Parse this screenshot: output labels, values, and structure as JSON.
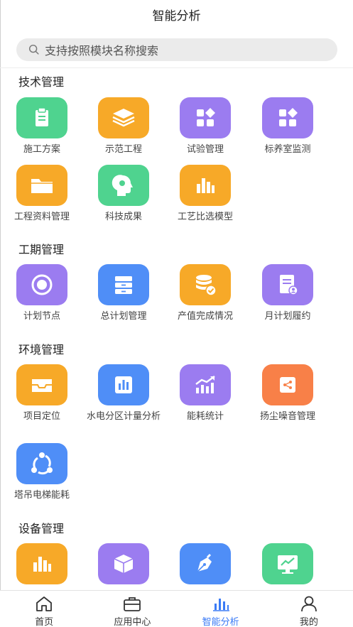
{
  "header": {
    "title": "智能分析"
  },
  "search": {
    "placeholder": "支持按照模块名称搜索"
  },
  "sections": [
    {
      "title": "技术管理",
      "items": [
        {
          "label": "施工方案",
          "icon": "clipboard-icon",
          "color": "#4fd38f"
        },
        {
          "label": "示范工程",
          "icon": "layers-icon",
          "color": "#f7a928"
        },
        {
          "label": "试验管理",
          "icon": "apps-grid-icon",
          "color": "#9b7cf0"
        },
        {
          "label": "标养室监测",
          "icon": "apps-grid-icon",
          "color": "#9b7cf0"
        },
        {
          "label": "工程资料管理",
          "icon": "folder-icon",
          "color": "#f7a928"
        },
        {
          "label": "科技成果",
          "icon": "head-brain-icon",
          "color": "#4fd38f"
        },
        {
          "label": "工艺比选模型",
          "icon": "bar-chart-icon",
          "color": "#f7a928"
        }
      ]
    },
    {
      "title": "工期管理",
      "items": [
        {
          "label": "计划节点",
          "icon": "circle-node-icon",
          "color": "#9b7cf0"
        },
        {
          "label": "总计划管理",
          "icon": "cabinet-icon",
          "color": "#4f8ef7"
        },
        {
          "label": "产值完成情况",
          "icon": "database-check-icon",
          "color": "#f7a928"
        },
        {
          "label": "月计划履约",
          "icon": "document-user-icon",
          "color": "#9b7cf0"
        }
      ]
    },
    {
      "title": "环境管理",
      "items": [
        {
          "label": "项目定位",
          "icon": "inbox-tray-icon",
          "color": "#f7a928"
        },
        {
          "label": "水电分区计量分析",
          "icon": "bar-chart-icon",
          "color": "#4f8ef7"
        },
        {
          "label": "能耗统计",
          "icon": "trend-chart-icon",
          "color": "#9b7cf0"
        },
        {
          "label": "扬尘噪音管理",
          "icon": "share-box-icon",
          "color": "#f88048"
        },
        {
          "label": "塔吊电梯能耗",
          "icon": "share-nodes-icon",
          "color": "#4f8ef7"
        }
      ]
    },
    {
      "title": "设备管理",
      "items": [
        {
          "label": "",
          "icon": "bar-chart-icon",
          "color": "#f7a928"
        },
        {
          "label": "",
          "icon": "cube-icon",
          "color": "#9b7cf0"
        },
        {
          "label": "",
          "icon": "pen-nib-icon",
          "color": "#4f8ef7"
        },
        {
          "label": "",
          "icon": "monitor-trend-icon",
          "color": "#4fd38f"
        }
      ]
    }
  ],
  "tabbar": [
    {
      "label": "首页",
      "icon": "home-icon",
      "active": false
    },
    {
      "label": "应用中心",
      "icon": "briefcase-icon",
      "active": false
    },
    {
      "label": "智能分析",
      "icon": "bar-chart-icon",
      "active": true
    },
    {
      "label": "我的",
      "icon": "user-icon",
      "active": false
    }
  ],
  "colors": {
    "accent": "#3b7bf6",
    "green": "#4fd38f",
    "orange": "#f7a928",
    "purple": "#9b7cf0",
    "blue": "#4f8ef7",
    "coral": "#f88048"
  }
}
